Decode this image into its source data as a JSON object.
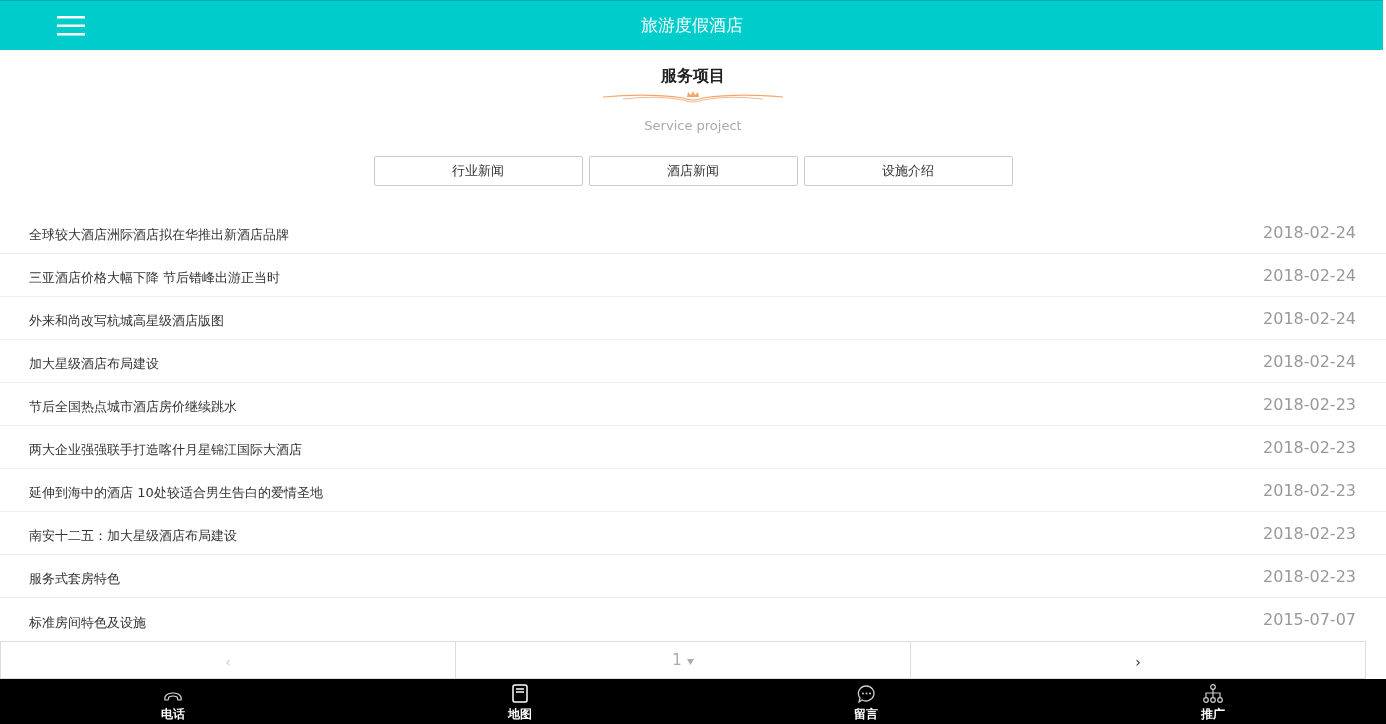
{
  "header": {
    "title": "旅游度假酒店"
  },
  "section": {
    "title": "服务项目",
    "subtitle": "Service project"
  },
  "tabs": [
    {
      "label": "行业新闻"
    },
    {
      "label": "酒店新闻"
    },
    {
      "label": "设施介绍"
    }
  ],
  "news": [
    {
      "title": "全球较大酒店洲际酒店拟在华推出新酒店品牌",
      "date": "2018-02-24"
    },
    {
      "title": "三亚酒店价格大幅下降 节后错峰出游正当时",
      "date": "2018-02-24"
    },
    {
      "title": "外来和尚改写杭城高星级酒店版图",
      "date": "2018-02-24"
    },
    {
      "title": "加大星级酒店布局建设",
      "date": "2018-02-24"
    },
    {
      "title": "节后全国热点城市酒店房价继续跳水",
      "date": "2018-02-23"
    },
    {
      "title": "两大企业强强联手打造喀什月星锦江国际大酒店",
      "date": "2018-02-23"
    },
    {
      "title": "延伸到海中的酒店 10处较适合男生告白的爱情圣地",
      "date": "2018-02-23"
    },
    {
      "title": "南安十二五：加大星级酒店布局建设",
      "date": "2018-02-23"
    },
    {
      "title": "服务式套房特色",
      "date": "2018-02-23"
    },
    {
      "title": "标准房间特色及设施",
      "date": "2015-07-07"
    }
  ],
  "pager": {
    "prev": {
      "label": "‹",
      "disabled": true
    },
    "page": "1",
    "next": {
      "label": "›",
      "disabled": false
    }
  },
  "footer": [
    {
      "kind": "phone",
      "label": "电话"
    },
    {
      "kind": "map",
      "label": "地图"
    },
    {
      "kind": "message",
      "label": "留言"
    },
    {
      "kind": "share",
      "label": "推广"
    }
  ]
}
